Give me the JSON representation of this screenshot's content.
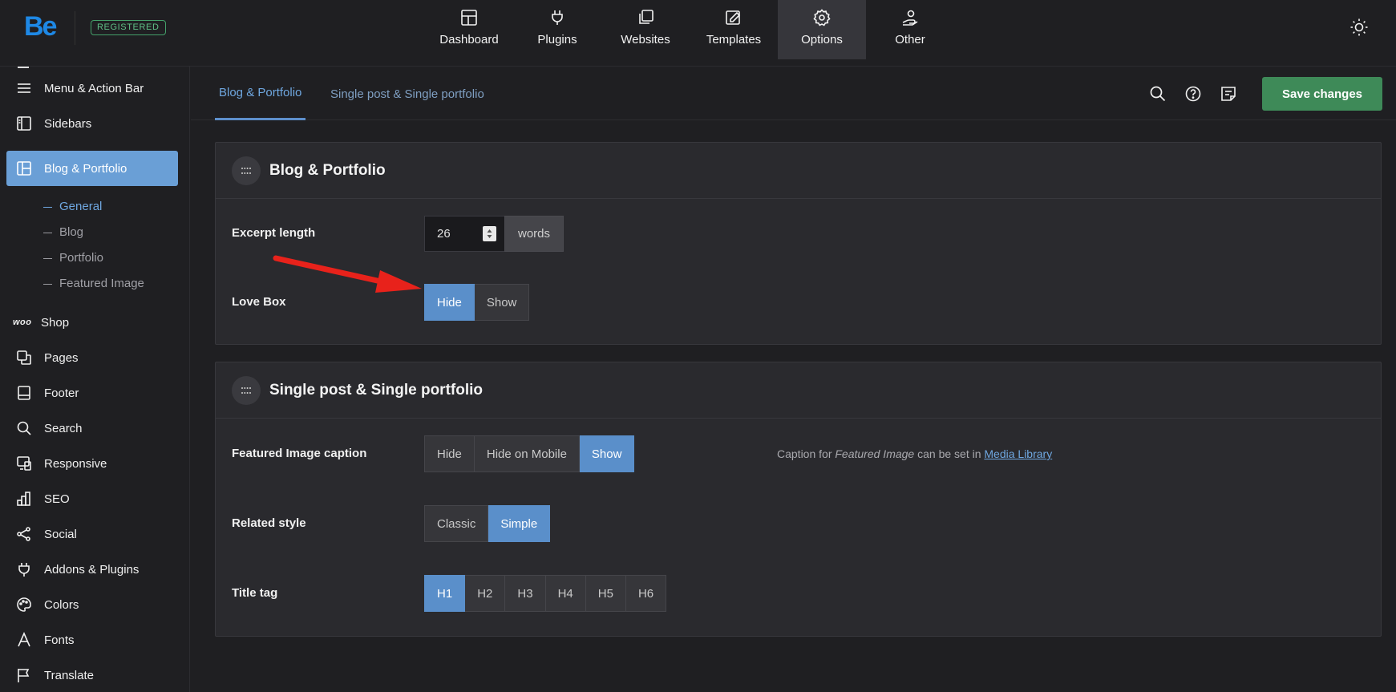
{
  "app": {
    "logo": "Be",
    "badge": "REGISTERED",
    "nav": [
      {
        "label": "Dashboard",
        "icon": "dashboard-icon"
      },
      {
        "label": "Plugins",
        "icon": "plug-icon"
      },
      {
        "label": "Websites",
        "icon": "websites-icon"
      },
      {
        "label": "Templates",
        "icon": "templates-icon"
      },
      {
        "label": "Options",
        "icon": "gear-icon",
        "active": true
      },
      {
        "label": "Other",
        "icon": "user-hand-icon"
      }
    ]
  },
  "sidebar": {
    "items": [
      {
        "label": "Menu & Action Bar",
        "icon": "menu-icon"
      },
      {
        "label": "Sidebars",
        "icon": "sidebar-icon"
      },
      {
        "label": "Blog & Portfolio",
        "icon": "layout-icon",
        "active": true
      },
      {
        "label": "Shop",
        "icon": "woo-icon"
      },
      {
        "label": "Pages",
        "icon": "pages-icon"
      },
      {
        "label": "Footer",
        "icon": "footer-icon"
      },
      {
        "label": "Search",
        "icon": "search-icon"
      },
      {
        "label": "Responsive",
        "icon": "responsive-icon"
      },
      {
        "label": "SEO",
        "icon": "seo-icon"
      },
      {
        "label": "Social",
        "icon": "share-icon"
      },
      {
        "label": "Addons & Plugins",
        "icon": "plug-icon"
      },
      {
        "label": "Colors",
        "icon": "palette-icon"
      },
      {
        "label": "Fonts",
        "icon": "font-icon"
      },
      {
        "label": "Translate",
        "icon": "flag-icon"
      }
    ],
    "woo_text": "woo",
    "subitems": [
      {
        "label": "General",
        "active": true
      },
      {
        "label": "Blog"
      },
      {
        "label": "Portfolio"
      },
      {
        "label": "Featured Image"
      }
    ]
  },
  "header": {
    "tabs": [
      {
        "label": "Blog & Portfolio",
        "active": true
      },
      {
        "label": "Single post & Single portfolio"
      }
    ],
    "save_label": "Save changes"
  },
  "panels": {
    "blog": {
      "title": "Blog & Portfolio",
      "excerpt_label": "Excerpt length",
      "excerpt_value": "26",
      "excerpt_unit": "words",
      "lovebox_label": "Love Box",
      "lovebox_options": [
        "Hide",
        "Show"
      ],
      "lovebox_selected": "Hide"
    },
    "single": {
      "title": "Single post & Single portfolio",
      "caption_label": "Featured Image caption",
      "caption_options": [
        "Hide",
        "Hide on Mobile",
        "Show"
      ],
      "caption_selected": "Show",
      "caption_hint_pre": "Caption for ",
      "caption_hint_em": "Featured Image",
      "caption_hint_mid": " can be set in ",
      "caption_hint_link": "Media Library",
      "related_label": "Related style",
      "related_options": [
        "Classic",
        "Simple"
      ],
      "related_selected": "Simple",
      "title_tag_label": "Title tag",
      "title_tag_options": [
        "H1",
        "H2",
        "H3",
        "H4",
        "H5",
        "H6"
      ],
      "title_tag_selected": "H1"
    }
  },
  "colors": {
    "accent": "#5a8fca",
    "save": "#3e8a58",
    "arrow": "#e8221b"
  }
}
